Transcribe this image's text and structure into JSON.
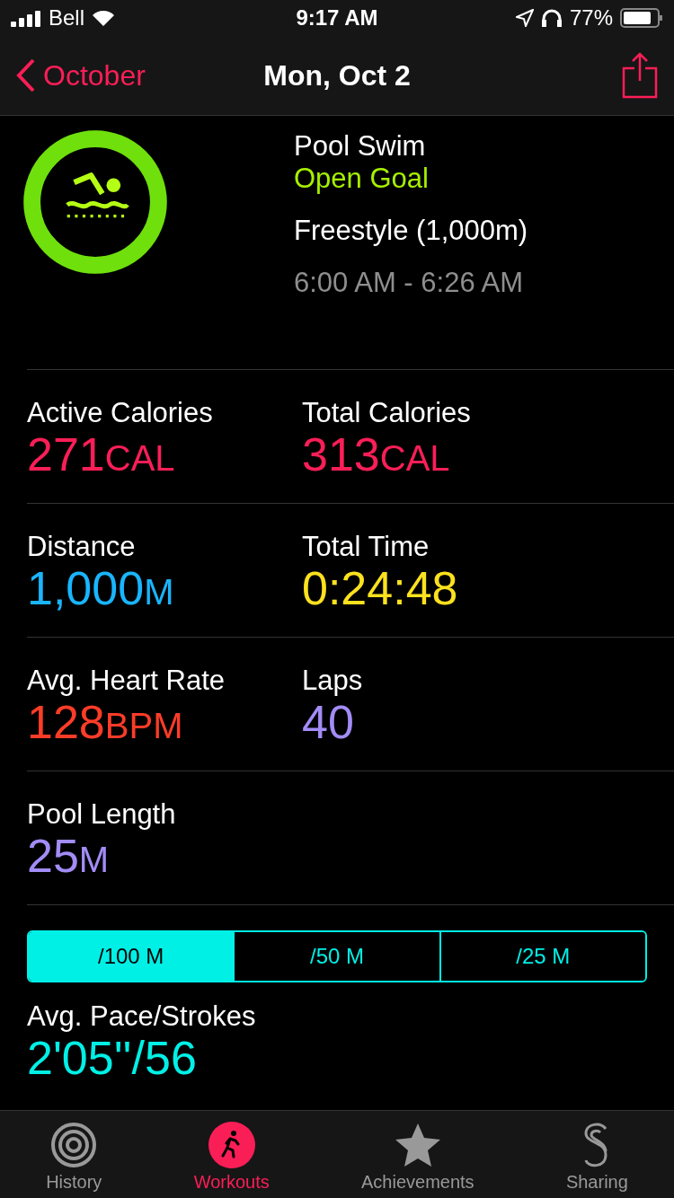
{
  "status_bar": {
    "carrier": "Bell",
    "time": "9:17 AM",
    "battery": "77%"
  },
  "nav": {
    "back": "October",
    "title": "Mon, Oct 2"
  },
  "workout": {
    "name": "Pool Swim",
    "goal": "Open Goal",
    "stroke": "Freestyle (1,000m)",
    "time_range": "6:00 AM - 6:26 AM"
  },
  "metrics": [
    [
      {
        "label": "Active Calories",
        "value": "271",
        "unit": "CAL",
        "color": "#fa1e57"
      },
      {
        "label": "Total Calories",
        "value": "313",
        "unit": "CAL",
        "color": "#fa1e57"
      }
    ],
    [
      {
        "label": "Distance",
        "value": "1,000",
        "unit": "M",
        "color": "#19b5fe"
      },
      {
        "label": "Total Time",
        "value": "0:24:48",
        "color": "#fce11e"
      }
    ],
    [
      {
        "label": "Avg. Heart Rate",
        "value": "128",
        "unit": "BPM",
        "color": "#fd3c28"
      },
      {
        "label": "Laps",
        "value": "40",
        "color": "#a28cf6"
      }
    ],
    [
      {
        "label": "Pool Length",
        "value": "25",
        "unit": "M",
        "color": "#a28cf6"
      }
    ]
  ],
  "segments": [
    {
      "label": "/100 M",
      "selected": true
    },
    {
      "label": "/50 M",
      "selected": false
    },
    {
      "label": "/25 M",
      "selected": false
    }
  ],
  "pace": {
    "label": "Avg. Pace/Strokes",
    "value": "2'05''/56"
  },
  "tabs": [
    {
      "label": "History",
      "selected": false
    },
    {
      "label": "Workouts",
      "selected": true
    },
    {
      "label": "Achievements",
      "selected": false
    },
    {
      "label": "Sharing",
      "selected": false
    }
  ]
}
